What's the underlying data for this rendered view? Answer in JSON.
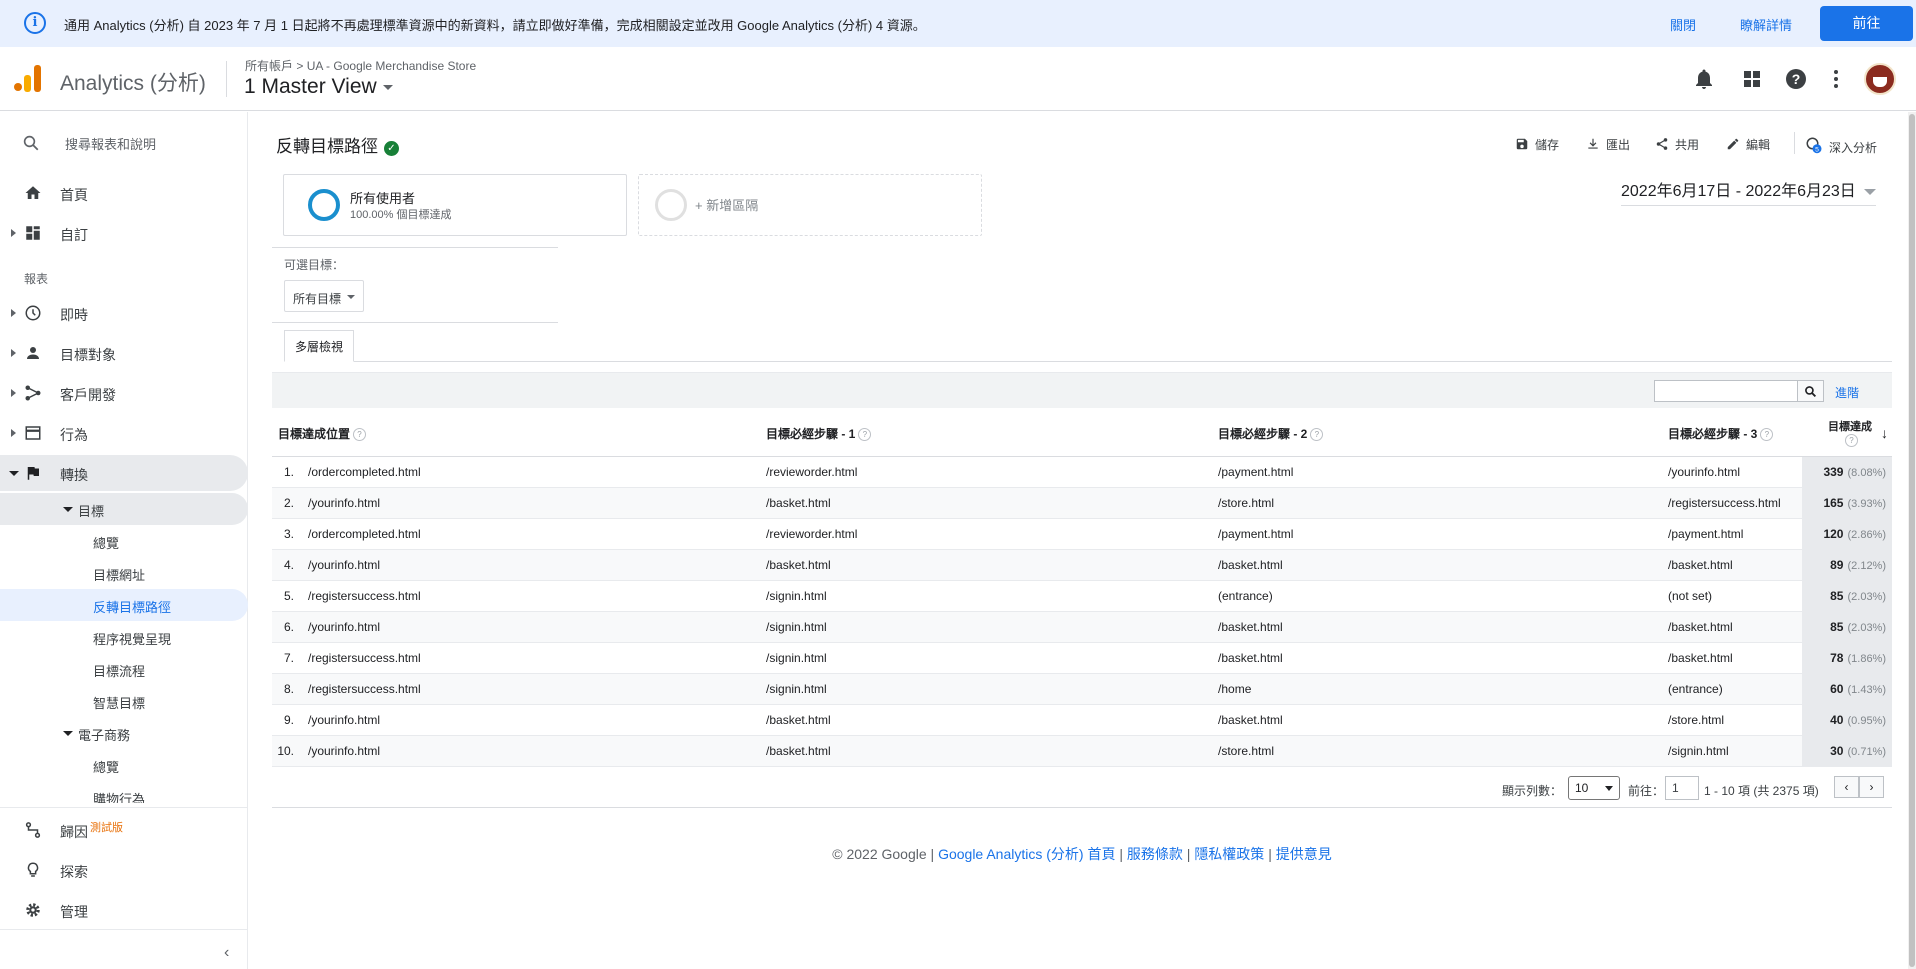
{
  "banner": {
    "message": "通用 Analytics (分析) 自 2023 年 7 月 1 日起將不再處理標準資源中的新資料，請立即做好準備，完成相關設定並改用 Google Analytics (分析) 4 資源。",
    "close_label": "關閉",
    "learn_more_label": "瞭解詳情",
    "go_label": "前往"
  },
  "header": {
    "app_name": "Analytics (分析)",
    "breadcrumb_root": "所有帳戶",
    "breadcrumb_sep": ">",
    "breadcrumb_property": "UA - Google Merchandise Store",
    "view_name": "1 Master View"
  },
  "sidebar": {
    "search_label": "搜尋報表和說明",
    "home": "首頁",
    "customization": "自訂",
    "reports_section": "報表",
    "realtime": "即時",
    "audience": "目標對象",
    "acquisition": "客戶開發",
    "behavior": "行為",
    "conversions": "轉換",
    "goals": "目標",
    "goals_items": [
      "總覽",
      "目標網址",
      "反轉目標路徑",
      "程序視覺呈現",
      "目標流程",
      "智慧目標"
    ],
    "ecommerce": "電子商務",
    "ecommerce_items": [
      "總覽",
      "購物行為"
    ],
    "attribution": "歸因",
    "beta": "測試版",
    "discover": "探索",
    "admin": "管理",
    "collapse": "‹"
  },
  "report": {
    "title": "反轉目標路徑",
    "toolbar": {
      "save": "儲存",
      "export": "匯出",
      "share": "共用",
      "edit": "編輯",
      "insights": "深入分析",
      "insights_badge": "5"
    },
    "segment": {
      "name": "所有使用者",
      "detail": "100.00% 個目標達成"
    },
    "add_segment": "+ 新增區隔",
    "date_range": "2022年6月17日 - 2022年6月23日",
    "goal_option_label": "可選目標：",
    "goal_option_value": "所有目標",
    "tab_label": "多層檢視",
    "advanced": "進階",
    "columns": {
      "location": "目標達成位置",
      "step1": "目標必經步驟 - 1",
      "step2": "目標必經步驟 - 2",
      "step3": "目標必經步驟 - 3",
      "completions": "目標達成"
    },
    "rows": [
      {
        "idx": "1.",
        "location": "/ordercompleted.html",
        "step1": "/revieworder.html",
        "step2": "/payment.html",
        "step3": "/yourinfo.html",
        "value": "339",
        "pct": "(8.08%)"
      },
      {
        "idx": "2.",
        "location": "/yourinfo.html",
        "step1": "/basket.html",
        "step2": "/store.html",
        "step3": "/registersuccess.html",
        "value": "165",
        "pct": "(3.93%)"
      },
      {
        "idx": "3.",
        "location": "/ordercompleted.html",
        "step1": "/revieworder.html",
        "step2": "/payment.html",
        "step3": "/payment.html",
        "value": "120",
        "pct": "(2.86%)"
      },
      {
        "idx": "4.",
        "location": "/yourinfo.html",
        "step1": "/basket.html",
        "step2": "/basket.html",
        "step3": "/basket.html",
        "value": "89",
        "pct": "(2.12%)"
      },
      {
        "idx": "5.",
        "location": "/registersuccess.html",
        "step1": "/signin.html",
        "step2": "(entrance)",
        "step3": "(not set)",
        "value": "85",
        "pct": "(2.03%)"
      },
      {
        "idx": "6.",
        "location": "/yourinfo.html",
        "step1": "/signin.html",
        "step2": "/basket.html",
        "step3": "/basket.html",
        "value": "85",
        "pct": "(2.03%)"
      },
      {
        "idx": "7.",
        "location": "/registersuccess.html",
        "step1": "/signin.html",
        "step2": "/basket.html",
        "step3": "/basket.html",
        "value": "78",
        "pct": "(1.86%)"
      },
      {
        "idx": "8.",
        "location": "/registersuccess.html",
        "step1": "/signin.html",
        "step2": "/home",
        "step3": "(entrance)",
        "value": "60",
        "pct": "(1.43%)"
      },
      {
        "idx": "9.",
        "location": "/yourinfo.html",
        "step1": "/basket.html",
        "step2": "/basket.html",
        "step3": "/store.html",
        "value": "40",
        "pct": "(0.95%)"
      },
      {
        "idx": "10.",
        "location": "/yourinfo.html",
        "step1": "/basket.html",
        "step2": "/store.html",
        "step3": "/signin.html",
        "value": "30",
        "pct": "(0.71%)"
      }
    ],
    "pager": {
      "rows_label": "顯示列數：",
      "rows_value": "10",
      "goto_label": "前往：",
      "goto_value": "1",
      "range": "1 - 10 項 (共 2375 項)",
      "prev": "‹",
      "next": "›"
    }
  },
  "footer": {
    "copyright": "© 2022 Google",
    "sep": "|",
    "home_link": "Google Analytics (分析) 首頁",
    "terms": "服務條款",
    "privacy": "隱私權政策",
    "feedback": "提供意見"
  },
  "colors": {
    "accent": "#1a73e8",
    "banner_bg": "#e8f0fe",
    "verified": "#188038",
    "segment_ring": "#1a8fce",
    "beta": "#e8710a"
  }
}
